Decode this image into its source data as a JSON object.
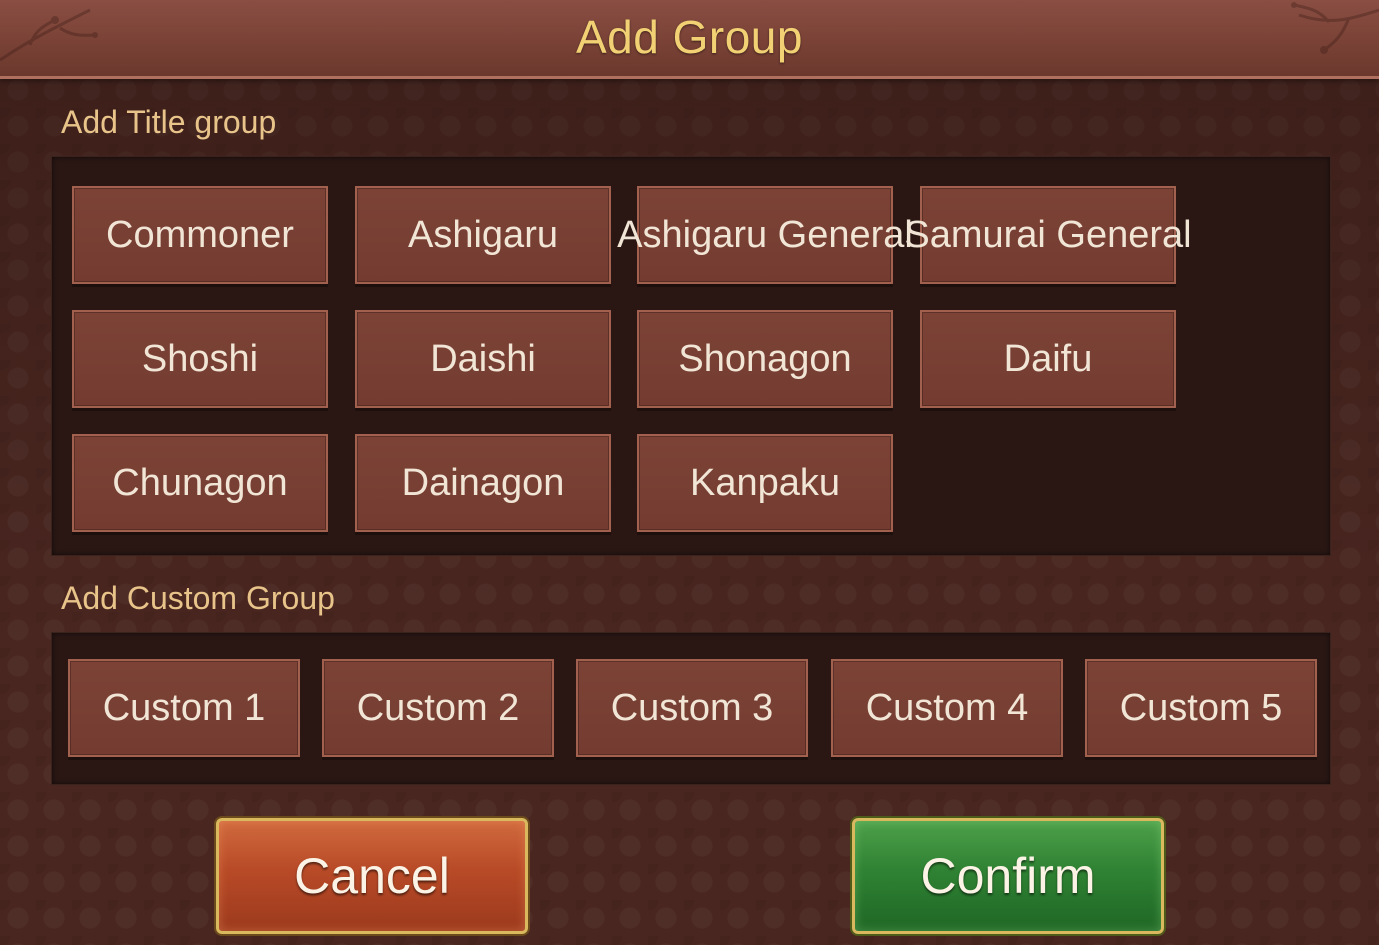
{
  "dialog": {
    "title": "Add Group"
  },
  "title_section": {
    "label": "Add Title group",
    "items": [
      "Commoner",
      "Ashigaru",
      "Ashigaru General",
      "Samurai General",
      "Shoshi",
      "Daishi",
      "Shonagon",
      "Daifu",
      "Chunagon",
      "Dainagon",
      "Kanpaku"
    ]
  },
  "custom_section": {
    "label": "Add Custom Group",
    "items": [
      "Custom 1",
      "Custom 2",
      "Custom 3",
      "Custom 4",
      "Custom 5"
    ]
  },
  "actions": {
    "cancel_label": "Cancel",
    "confirm_label": "Confirm"
  },
  "colors": {
    "title_text": "#f2d175",
    "section_label": "#e8c48a",
    "cancel_button": "#b84a27",
    "confirm_button": "#2f8233"
  }
}
